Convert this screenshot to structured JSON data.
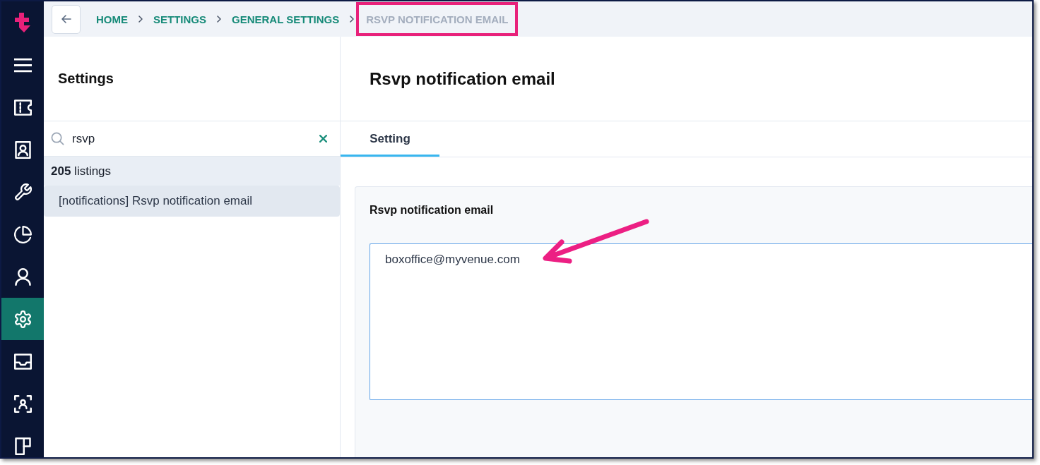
{
  "nav": {
    "items": [
      {
        "kind": "menu",
        "selected": false
      },
      {
        "kind": "ticket",
        "selected": false
      },
      {
        "kind": "contact",
        "selected": false
      },
      {
        "kind": "wrench",
        "selected": false
      },
      {
        "kind": "pie",
        "selected": false
      },
      {
        "kind": "user",
        "selected": false
      },
      {
        "kind": "gear",
        "selected": true
      },
      {
        "kind": "inbox",
        "selected": false
      },
      {
        "kind": "scan",
        "selected": false
      },
      {
        "kind": "layout",
        "selected": false
      }
    ]
  },
  "breadcrumb": {
    "items": [
      {
        "label": "HOME",
        "current": false,
        "highlighted": false
      },
      {
        "label": "SETTINGS",
        "current": false,
        "highlighted": false
      },
      {
        "label": "GENERAL SETTINGS",
        "current": false,
        "highlighted": false
      },
      {
        "label": "RSVP NOTIFICATION EMAIL",
        "current": true,
        "highlighted": true
      }
    ]
  },
  "sidebar": {
    "title": "Settings",
    "search": {
      "value": "rsvp"
    },
    "count": "**205** listings",
    "items": [
      {
        "label": "[notifications] Rsvp notification email",
        "selected": true
      }
    ]
  },
  "page": {
    "title": "Rsvp notification email",
    "tabs": [
      {
        "label": "Setting",
        "selected": true
      }
    ],
    "card": {
      "label": "Rsvp notification email",
      "value": "boxoffice@myvenue.com",
      "arrow": true
    }
  }
}
